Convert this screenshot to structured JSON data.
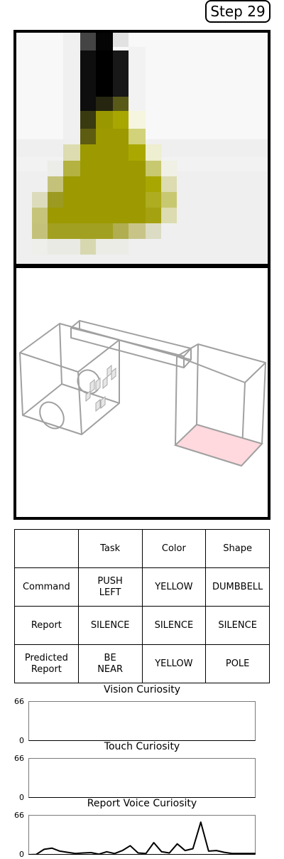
{
  "step": {
    "label": "Step 29"
  },
  "vision_view": {
    "name": "robot-camera-view",
    "pixel_colors": [
      "#9c9a00",
      "#0c0c0c",
      "#efefef"
    ]
  },
  "scene_view": {
    "name": "simulation-scene",
    "highlight_color": "#ffd9de"
  },
  "report_table": {
    "headers": [
      "",
      "Task",
      "Color",
      "Shape"
    ],
    "rows": [
      {
        "label": "Command",
        "task": "PUSH LEFT",
        "color": "YELLOW",
        "shape": "DUMBBELL"
      },
      {
        "label": "Report",
        "task": "SILENCE",
        "color": "SILENCE",
        "shape": "SILENCE"
      },
      {
        "label": "Predicted Report",
        "task": "BE NEAR",
        "color": "YELLOW",
        "shape": "POLE"
      }
    ]
  },
  "curiosity": {
    "vision": {
      "title": "Vision Curiosity",
      "y_max": "66",
      "y_min": "0",
      "ylim": [
        0,
        66
      ],
      "values": []
    },
    "touch": {
      "title": "Touch Curiosity",
      "y_max": "66",
      "y_min": "0",
      "ylim": [
        0,
        66
      ],
      "values": []
    },
    "voice": {
      "title": "Report Voice Curiosity",
      "y_max": "66",
      "y_min": "0",
      "ylim": [
        0,
        66
      ],
      "values": [
        0,
        0.5,
        9,
        11,
        6,
        4,
        2,
        3,
        3.5,
        1,
        5,
        2,
        7,
        15,
        3,
        2,
        20,
        5,
        3,
        18,
        7,
        10,
        54,
        6,
        7,
        4,
        2,
        2,
        2,
        2
      ]
    }
  },
  "chart_data": [
    {
      "type": "line",
      "title": "Vision Curiosity",
      "ylim": [
        0,
        66
      ],
      "series": [
        {
          "values": []
        }
      ]
    },
    {
      "type": "line",
      "title": "Touch Curiosity",
      "ylim": [
        0,
        66
      ],
      "series": [
        {
          "values": []
        }
      ]
    },
    {
      "type": "line",
      "title": "Report Voice Curiosity",
      "ylim": [
        0,
        66
      ],
      "series": [
        {
          "values": [
            0,
            0.5,
            9,
            11,
            6,
            4,
            2,
            3,
            3.5,
            1,
            5,
            2,
            7,
            15,
            3,
            2,
            20,
            5,
            3,
            18,
            7,
            10,
            54,
            6,
            7,
            4,
            2,
            2,
            2,
            2
          ]
        }
      ]
    }
  ]
}
